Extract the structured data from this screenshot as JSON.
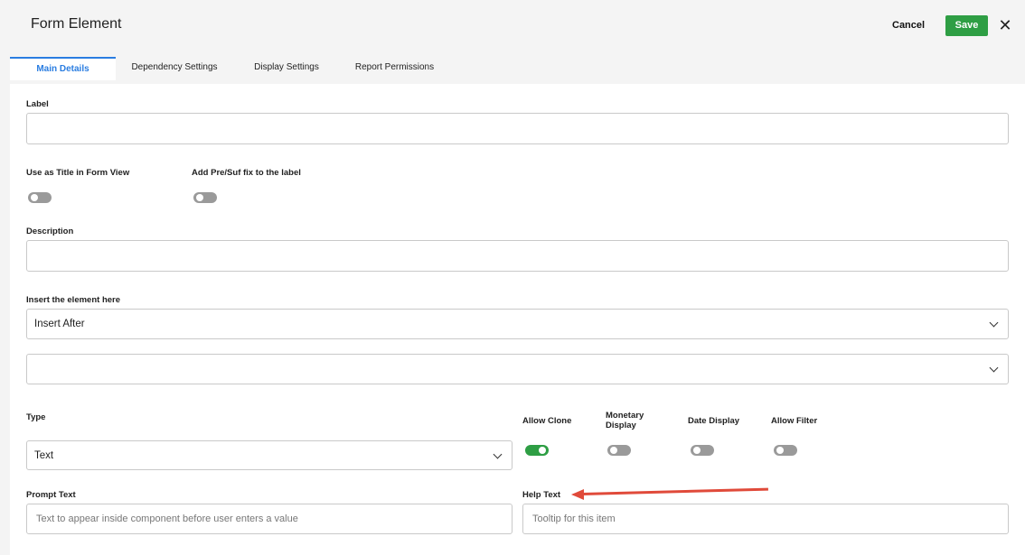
{
  "header": {
    "title": "Form Element",
    "cancel_label": "Cancel",
    "save_label": "Save",
    "close_glyph": "✕"
  },
  "tabs": [
    {
      "label": "Main Details",
      "active": true
    },
    {
      "label": "Dependency Settings",
      "active": false
    },
    {
      "label": "Display Settings",
      "active": false
    },
    {
      "label": "Report Permissions",
      "active": false
    }
  ],
  "form": {
    "label": {
      "label": "Label",
      "value": ""
    },
    "use_as_title": {
      "label": "Use as Title in Form View",
      "on": false
    },
    "add_fix": {
      "label": "Add Pre/Suf fix to the label",
      "on": false
    },
    "description": {
      "label": "Description",
      "value": ""
    },
    "insert": {
      "label": "Insert the element here",
      "position_value": "Insert After",
      "element_value": ""
    },
    "type": {
      "label": "Type",
      "value": "Text"
    },
    "allow_clone": {
      "label": "Allow Clone",
      "on": true
    },
    "monetary_display": {
      "label": "Monetary\nDisplay",
      "on": false
    },
    "date_display": {
      "label": "Date Display",
      "on": false
    },
    "allow_filter": {
      "label": "Allow Filter",
      "on": false
    },
    "prompt_text": {
      "label": "Prompt Text",
      "placeholder": "Text to appear inside component before user enters a value"
    },
    "help_text": {
      "label": "Help Text",
      "placeholder": "Tooltip for this item"
    }
  },
  "colors": {
    "accent": "#2a7de1",
    "save_green": "#2e9e44",
    "annotation_arrow": "#e04a3a"
  },
  "icons": [
    "chevron-down-icon",
    "close-icon",
    "toggle-icon",
    "annotation-arrow"
  ]
}
